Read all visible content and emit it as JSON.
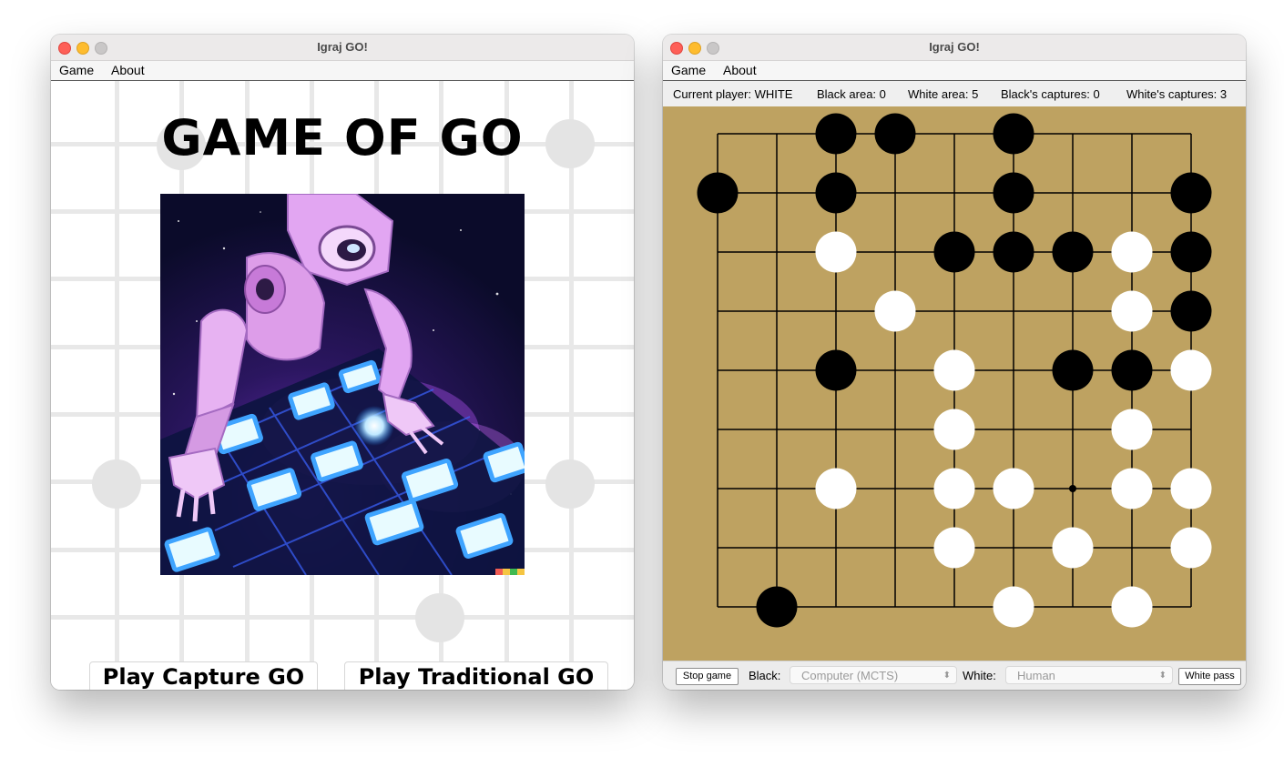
{
  "left_window": {
    "title": "Igraj GO!",
    "menu": [
      "Game",
      "About"
    ],
    "heading": "GAME OF GO",
    "buttons": {
      "capture": "Play Capture GO",
      "traditional": "Play Traditional GO"
    }
  },
  "right_window": {
    "title": "Igraj GO!",
    "menu": [
      "Game",
      "About"
    ],
    "status": {
      "current_player": "Current player: WHITE",
      "black_area": "Black area: 0",
      "white_area": "White area: 5",
      "black_captures": "Black's captures: 0",
      "white_captures": "White's captures: 3"
    },
    "board": {
      "size": 9,
      "black": [
        [
          2,
          0
        ],
        [
          3,
          0
        ],
        [
          5,
          0
        ],
        [
          0,
          1
        ],
        [
          2,
          1
        ],
        [
          5,
          1
        ],
        [
          8,
          1
        ],
        [
          4,
          2
        ],
        [
          5,
          2
        ],
        [
          6,
          2
        ],
        [
          8,
          2
        ],
        [
          8,
          3
        ],
        [
          2,
          4
        ],
        [
          6,
          4
        ],
        [
          7,
          4
        ],
        [
          1,
          8
        ]
      ],
      "white": [
        [
          2,
          2
        ],
        [
          7,
          2
        ],
        [
          3,
          3
        ],
        [
          7,
          3
        ],
        [
          4,
          4
        ],
        [
          8,
          4
        ],
        [
          4,
          5
        ],
        [
          7,
          5
        ],
        [
          2,
          6
        ],
        [
          4,
          6
        ],
        [
          5,
          6
        ],
        [
          7,
          6
        ],
        [
          8,
          6
        ],
        [
          4,
          7
        ],
        [
          6,
          7
        ],
        [
          8,
          7
        ],
        [
          5,
          8
        ],
        [
          7,
          8
        ]
      ],
      "star_points": [
        [
          6,
          6
        ]
      ],
      "board_color": "#bea261"
    },
    "controls": {
      "stop_game": "Stop game",
      "black_label": "Black:",
      "black_player": "Computer (MCTS)",
      "white_label": "White:",
      "white_player": "Human",
      "white_pass": "White pass"
    }
  }
}
